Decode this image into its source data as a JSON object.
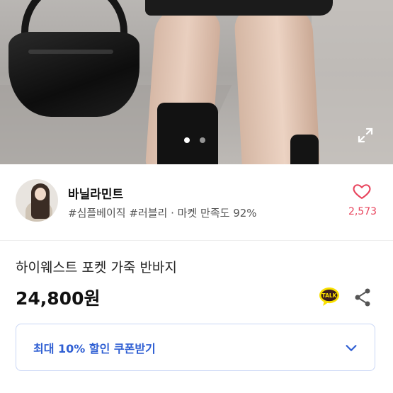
{
  "gallery": {
    "image_count": 2,
    "active_index": 0
  },
  "seller": {
    "name": "바닐라민트",
    "tags": "#심플베이직 #러블리",
    "separator": "·",
    "satisfaction": "마켓 만족도 92%",
    "like_count": "2,573"
  },
  "product": {
    "title": "하이웨스트 포켓 가죽 반바지",
    "price": "24,800원"
  },
  "talk_badge": "TALK",
  "coupon": {
    "label": "최대 10% 할인 쿠폰받기"
  },
  "icons": {
    "expand": "expand-icon",
    "heart": "heart-icon",
    "talk": "kakao-talk-icon",
    "share": "share-icon",
    "chevron": "chevron-down-icon"
  },
  "colors": {
    "accent_pink": "#e8435c",
    "coupon_blue": "#2f5fd3",
    "coupon_border": "#c9d6f5",
    "talk_yellow": "#f9e000"
  }
}
